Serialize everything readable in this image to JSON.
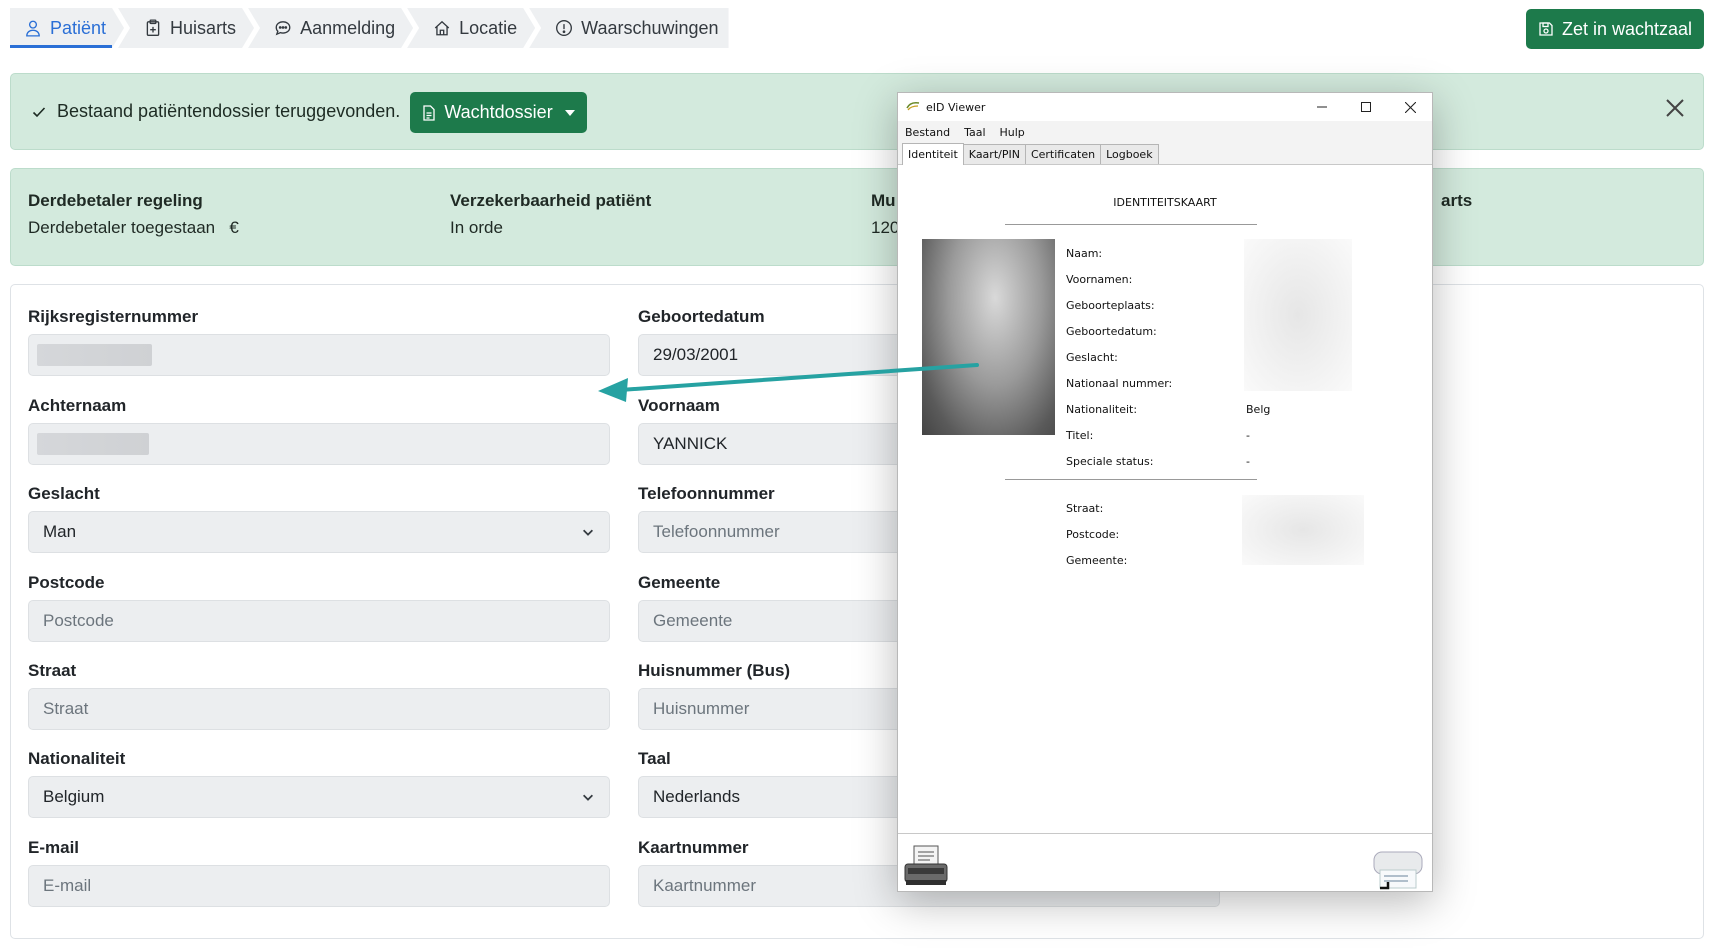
{
  "tabs": [
    {
      "label": "Patiënt",
      "icon": "person-icon",
      "active": true
    },
    {
      "label": "Huisarts",
      "icon": "clipboard-plus-icon",
      "active": false
    },
    {
      "label": "Aanmelding",
      "icon": "chat-icon",
      "active": false
    },
    {
      "label": "Locatie",
      "icon": "house-icon",
      "active": false
    },
    {
      "label": "Waarschuwingen",
      "icon": "exclamation-circle-icon",
      "active": false
    }
  ],
  "save_button": {
    "label": "Zet in wachtzaal",
    "icon": "floppy-icon"
  },
  "alert": {
    "message": "Bestaand patiëntendossier teruggevonden.",
    "dossier_button": "Wachtdossier",
    "accent": "#1d7a4b"
  },
  "info": {
    "derdebetaler": {
      "title": "Derdebetaler regeling",
      "value": "Derdebetaler toegestaan",
      "symbol": "€"
    },
    "verzekerbaarheid": {
      "title": "Verzekerbaarheid patiënt",
      "value": "In orde"
    },
    "mutualiteit": {
      "title": "Mu",
      "value": "120"
    },
    "huisarts": {
      "title": "arts"
    }
  },
  "form": {
    "rijksregisternummer": {
      "label": "Rijksregisternummer",
      "value": ""
    },
    "geboortedatum": {
      "label": "Geboortedatum",
      "value": "29/03/2001"
    },
    "achternaam": {
      "label": "Achternaam",
      "value": ""
    },
    "voornaam": {
      "label": "Voornaam",
      "value": "YANNICK"
    },
    "geslacht": {
      "label": "Geslacht",
      "value": "Man"
    },
    "telefoonnummer": {
      "label": "Telefoonnummer",
      "placeholder": "Telefoonnummer"
    },
    "postcode": {
      "label": "Postcode",
      "placeholder": "Postcode"
    },
    "gemeente": {
      "label": "Gemeente",
      "placeholder": "Gemeente"
    },
    "straat": {
      "label": "Straat",
      "placeholder": "Straat"
    },
    "huisnummer": {
      "label": "Huisnummer (Bus)",
      "placeholder": "Huisnummer"
    },
    "nationaliteit": {
      "label": "Nationaliteit",
      "value": "Belgium"
    },
    "taal": {
      "label": "Taal",
      "value": "Nederlands"
    },
    "email": {
      "label": "E-mail",
      "placeholder": "E-mail"
    },
    "kaartnummer": {
      "label": "Kaartnummer",
      "placeholder": "Kaartnummer"
    }
  },
  "eid": {
    "title": "eID Viewer",
    "menu": [
      "Bestand",
      "Taal",
      "Hulp"
    ],
    "tabs": [
      "Identiteit",
      "Kaart/PIN",
      "Certificaten",
      "Logboek"
    ],
    "heading": "IDENTITEITSKAART",
    "labels": {
      "naam": "Naam:",
      "voornamen": "Voornamen:",
      "geboorteplaats": "Geboorteplaats:",
      "geboortedatum": "Geboortedatum:",
      "geslacht": "Geslacht:",
      "nationaal_nummer": "Nationaal nummer:",
      "nationaliteit": "Nationaliteit:",
      "titel": "Titel:",
      "speciale_status": "Speciale status:",
      "straat": "Straat:",
      "postcode": "Postcode:",
      "gemeente": "Gemeente:"
    },
    "values": {
      "nationaliteit": "Belg",
      "titel": "-",
      "speciale_status": "-"
    }
  },
  "colors": {
    "primary": "#2a6fd6",
    "success": "#1d7a4b",
    "alert_bg": "#d3eadd",
    "arrow": "#26a2a2"
  }
}
